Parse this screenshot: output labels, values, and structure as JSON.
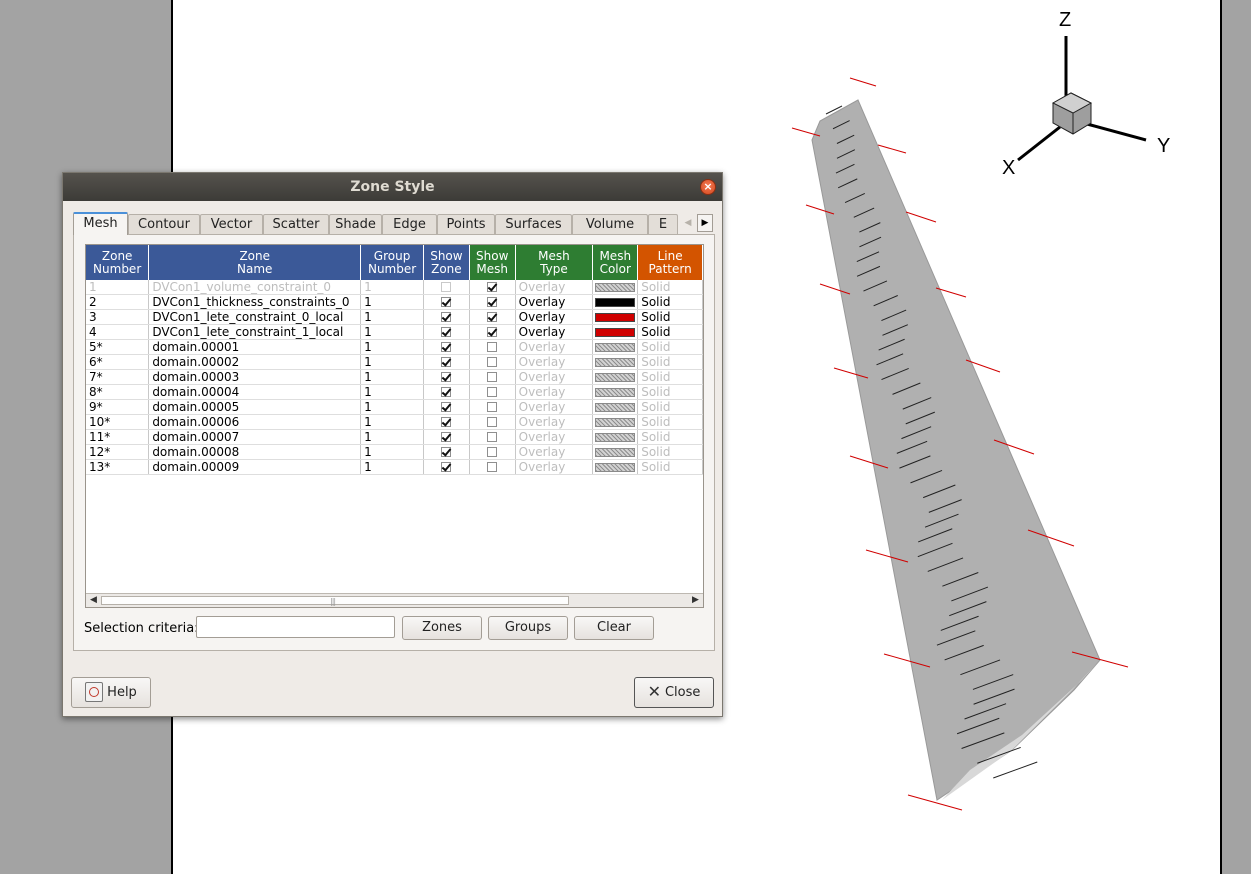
{
  "dialog": {
    "title": "Zone Style",
    "tabs": [
      "Mesh",
      "Contour",
      "Vector",
      "Scatter",
      "Shade",
      "Edge",
      "Points",
      "Surfaces",
      "Volume",
      "E"
    ],
    "active_tab": "Mesh",
    "columns": [
      {
        "line1": "Zone",
        "line2": "Number",
        "color": "blue"
      },
      {
        "line1": "Zone",
        "line2": "Name",
        "color": "blue"
      },
      {
        "line1": "Group",
        "line2": "Number",
        "color": "blue"
      },
      {
        "line1": "Show",
        "line2": "Zone",
        "color": "blue"
      },
      {
        "line1": "Show",
        "line2": "Mesh",
        "color": "green"
      },
      {
        "line1": "Mesh",
        "line2": "Type",
        "color": "green"
      },
      {
        "line1": "Mesh",
        "line2": "Color",
        "color": "green"
      },
      {
        "line1": "Line",
        "line2": "Pattern",
        "color": "orange"
      }
    ],
    "rows": [
      {
        "num": "1",
        "name": "DVCon1_volume_constraint_0",
        "group": "1",
        "show_zone": false,
        "show_mesh": true,
        "type": "Overlay",
        "color": "hatch",
        "pattern": "Solid",
        "dim_all": true
      },
      {
        "num": "2",
        "name": "DVCon1_thickness_constraints_0",
        "group": "1",
        "show_zone": true,
        "show_mesh": true,
        "type": "Overlay",
        "color": "#000000",
        "pattern": "Solid",
        "dim_all": false
      },
      {
        "num": "3",
        "name": "DVCon1_lete_constraint_0_local",
        "group": "1",
        "show_zone": true,
        "show_mesh": true,
        "type": "Overlay",
        "color": "#d00000",
        "pattern": "Solid",
        "dim_all": false
      },
      {
        "num": "4",
        "name": "DVCon1_lete_constraint_1_local",
        "group": "1",
        "show_zone": true,
        "show_mesh": true,
        "type": "Overlay",
        "color": "#d00000",
        "pattern": "Solid",
        "dim_all": false
      },
      {
        "num": "5*",
        "name": "domain.00001",
        "group": "1",
        "show_zone": true,
        "show_mesh": false,
        "type": "Overlay",
        "color": "hatch",
        "pattern": "Solid",
        "dim_all": false
      },
      {
        "num": "6*",
        "name": "domain.00002",
        "group": "1",
        "show_zone": true,
        "show_mesh": false,
        "type": "Overlay",
        "color": "hatch",
        "pattern": "Solid",
        "dim_all": false
      },
      {
        "num": "7*",
        "name": "domain.00003",
        "group": "1",
        "show_zone": true,
        "show_mesh": false,
        "type": "Overlay",
        "color": "hatch",
        "pattern": "Solid",
        "dim_all": false
      },
      {
        "num": "8*",
        "name": "domain.00004",
        "group": "1",
        "show_zone": true,
        "show_mesh": false,
        "type": "Overlay",
        "color": "hatch",
        "pattern": "Solid",
        "dim_all": false
      },
      {
        "num": "9*",
        "name": "domain.00005",
        "group": "1",
        "show_zone": true,
        "show_mesh": false,
        "type": "Overlay",
        "color": "hatch",
        "pattern": "Solid",
        "dim_all": false
      },
      {
        "num": "10*",
        "name": "domain.00006",
        "group": "1",
        "show_zone": true,
        "show_mesh": false,
        "type": "Overlay",
        "color": "hatch",
        "pattern": "Solid",
        "dim_all": false
      },
      {
        "num": "11*",
        "name": "domain.00007",
        "group": "1",
        "show_zone": true,
        "show_mesh": false,
        "type": "Overlay",
        "color": "hatch",
        "pattern": "Solid",
        "dim_all": false
      },
      {
        "num": "12*",
        "name": "domain.00008",
        "group": "1",
        "show_zone": true,
        "show_mesh": false,
        "type": "Overlay",
        "color": "hatch",
        "pattern": "Solid",
        "dim_all": false
      },
      {
        "num": "13*",
        "name": "domain.00009",
        "group": "1",
        "show_zone": true,
        "show_mesh": false,
        "type": "Overlay",
        "color": "hatch",
        "pattern": "Solid",
        "dim_all": false
      }
    ],
    "selection_label": "Selection criteria:",
    "selection_value": "",
    "buttons": {
      "zones": "Zones",
      "groups": "Groups",
      "clear": "Clear",
      "help": "Help",
      "close": "Close"
    }
  },
  "axes": {
    "z": "Z",
    "y": "Y",
    "x": "X"
  },
  "colors": {
    "header_blue": "#3b5998",
    "header_green": "#2e7d32",
    "header_orange": "#d35400",
    "constraint_red": "#d00000"
  }
}
